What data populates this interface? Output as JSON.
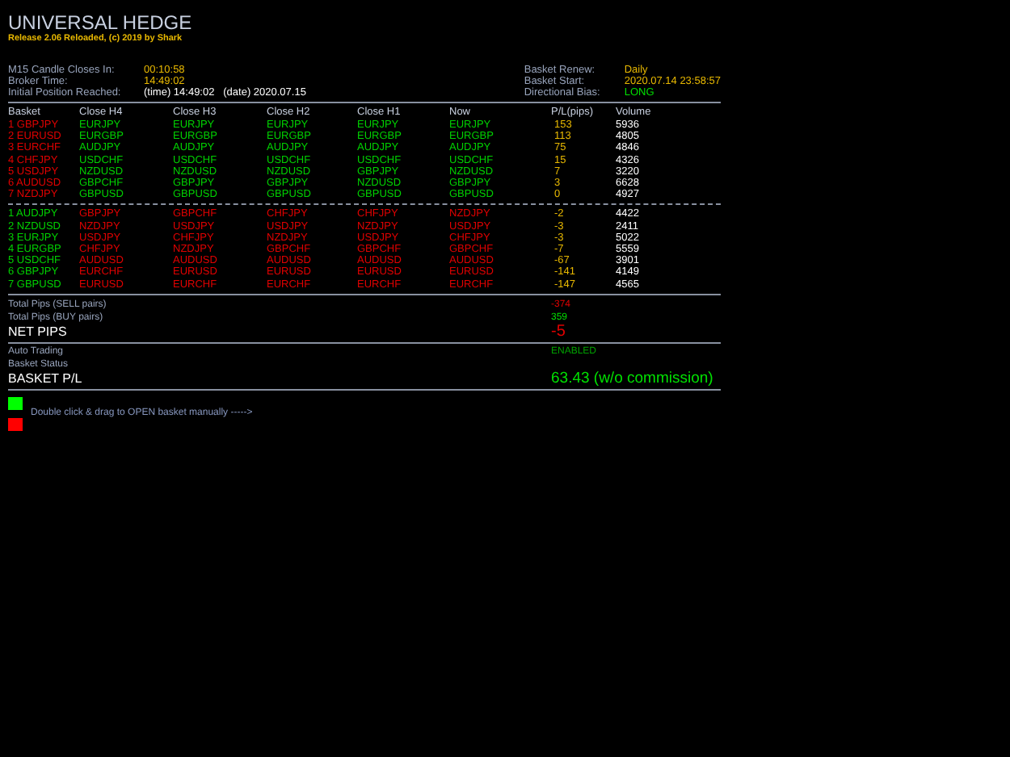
{
  "title": "UNIVERSAL HEDGE",
  "release": "Release 2.06 Reloaded, (c) 2019 by Shark",
  "info_left": [
    {
      "label": "M15 Candle Closes In:",
      "value": "00:10:58",
      "color": "#e8b800"
    },
    {
      "label": "Broker Time:",
      "value": "14:49:02",
      "color": "#e8b800"
    },
    {
      "label": "Initial Position Reached:",
      "value": "(time) 14:49:02   (date) 2020.07.15",
      "color": "#ffffff"
    }
  ],
  "info_right": [
    {
      "label": "Basket Renew:",
      "value": "Daily",
      "color": "#e8b800"
    },
    {
      "label": "Basket Start:",
      "value": "2020.07.14 23:58:57",
      "color": "#e8b800"
    },
    {
      "label": "Directional Bias:",
      "value": "LONG",
      "color": "#00e000"
    }
  ],
  "columns": [
    "Basket",
    "Close H4",
    "Close H3",
    "Close H2",
    "Close H1",
    "Now",
    "P/L(pips)",
    "Volume"
  ],
  "groups": [
    {
      "kind": "sell",
      "rows": [
        {
          "basket": "1 GBPJPY",
          "closes": [
            "EURJPY",
            "EURJPY",
            "EURJPY",
            "EURJPY",
            "EURJPY"
          ],
          "pl": "153",
          "volume": "5936"
        },
        {
          "basket": "2 EURUSD",
          "closes": [
            "EURGBP",
            "EURGBP",
            "EURGBP",
            "EURGBP",
            "EURGBP"
          ],
          "pl": "113",
          "volume": "4805"
        },
        {
          "basket": "3 EURCHF",
          "closes": [
            "AUDJPY",
            "AUDJPY",
            "AUDJPY",
            "AUDJPY",
            "AUDJPY"
          ],
          "pl": "75",
          "volume": "4846"
        },
        {
          "basket": "4 CHFJPY",
          "closes": [
            "USDCHF",
            "USDCHF",
            "USDCHF",
            "USDCHF",
            "USDCHF"
          ],
          "pl": "15",
          "volume": "4326"
        },
        {
          "basket": "5 USDJPY",
          "closes": [
            "NZDUSD",
            "NZDUSD",
            "NZDUSD",
            "GBPJPY",
            "NZDUSD"
          ],
          "pl": "7",
          "volume": "3220"
        },
        {
          "basket": "6 AUDUSD",
          "closes": [
            "GBPCHF",
            "GBPJPY",
            "GBPJPY",
            "NZDUSD",
            "GBPJPY"
          ],
          "pl": "3",
          "volume": "6628"
        },
        {
          "basket": "7 NZDJPY",
          "closes": [
            "GBPUSD",
            "GBPUSD",
            "GBPUSD",
            "GBPUSD",
            "GBPUSD"
          ],
          "pl": "0",
          "volume": "4927"
        }
      ]
    },
    {
      "kind": "buy",
      "rows": [
        {
          "basket": "1 AUDJPY",
          "closes": [
            "GBPJPY",
            "GBPCHF",
            "CHFJPY",
            "CHFJPY",
            "NZDJPY"
          ],
          "pl": "-2",
          "volume": "4422"
        },
        {
          "basket": "2 NZDUSD",
          "closes": [
            "NZDJPY",
            "USDJPY",
            "USDJPY",
            "NZDJPY",
            "USDJPY"
          ],
          "pl": "-3",
          "volume": "2411"
        },
        {
          "basket": "3 EURJPY",
          "closes": [
            "USDJPY",
            "CHFJPY",
            "NZDJPY",
            "USDJPY",
            "CHFJPY"
          ],
          "pl": "-3",
          "volume": "5022"
        },
        {
          "basket": "4 EURGBP",
          "closes": [
            "CHFJPY",
            "NZDJPY",
            "GBPCHF",
            "GBPCHF",
            "GBPCHF"
          ],
          "pl": "-7",
          "volume": "5559"
        },
        {
          "basket": "5 USDCHF",
          "closes": [
            "AUDUSD",
            "AUDUSD",
            "AUDUSD",
            "AUDUSD",
            "AUDUSD"
          ],
          "pl": "-67",
          "volume": "3901"
        },
        {
          "basket": "6 GBPJPY",
          "closes": [
            "EURCHF",
            "EURUSD",
            "EURUSD",
            "EURUSD",
            "EURUSD"
          ],
          "pl": "-141",
          "volume": "4149"
        },
        {
          "basket": "7 GBPUSD",
          "closes": [
            "EURUSD",
            "EURCHF",
            "EURCHF",
            "EURCHF",
            "EURCHF"
          ],
          "pl": "-147",
          "volume": "4565"
        }
      ]
    }
  ],
  "totals": [
    {
      "label": "Total Pips (SELL pairs)",
      "value": "-374",
      "color": "#e00000"
    },
    {
      "label": "Total Pips (BUY pairs)",
      "value": "359",
      "color": "#00e000"
    }
  ],
  "net_pips": {
    "label": "NET PIPS",
    "value": "-5",
    "color": "#e00000"
  },
  "status": [
    {
      "label": "Auto Trading",
      "value": "ENABLED",
      "color": "#00a000"
    },
    {
      "label": "Basket Status"
    }
  ],
  "basket_pl": {
    "label": "BASKET P/L",
    "value": "63.43 (w/o commission)",
    "color": "#00e000"
  },
  "buttons": [
    {
      "color": "#00ff00"
    },
    {
      "color": "#ff0000"
    }
  ],
  "hint": "Double click & drag to OPEN basket manually ----->"
}
